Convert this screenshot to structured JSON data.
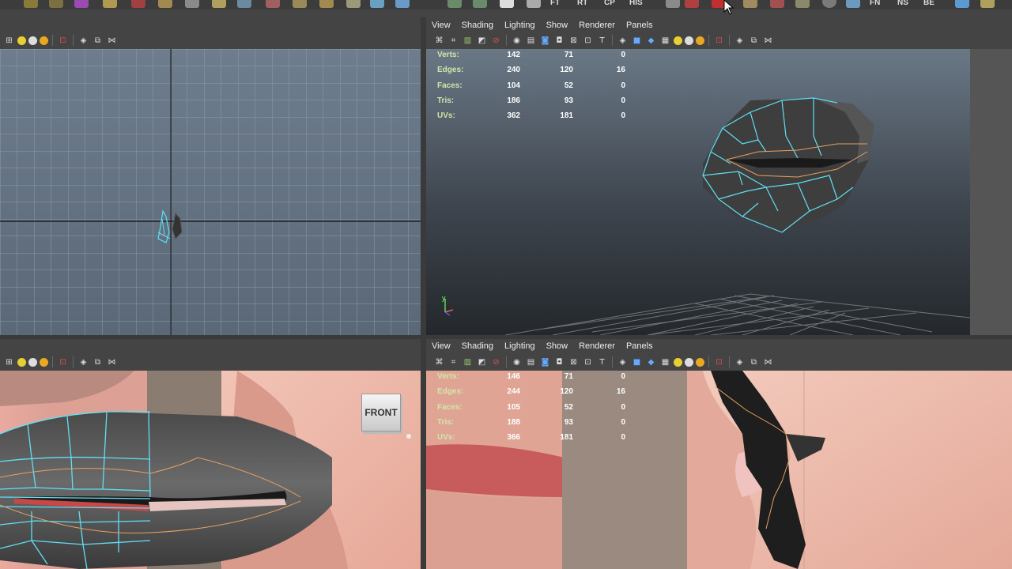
{
  "shelf": {
    "tabs": [
      "FT",
      "RT",
      "CP",
      "HIS",
      "FN",
      "NS",
      "BE"
    ],
    "icons": [
      "sphere-icon",
      "cube-icon",
      "cylinder-icon",
      "plane-icon",
      "lattice-icon",
      "bend-icon",
      "curve-icon",
      "text-icon",
      "camera-icon",
      "light-icon"
    ]
  },
  "panels": {
    "menu": [
      "View",
      "Shading",
      "Lighting",
      "Show",
      "Renderer",
      "Panels"
    ]
  },
  "viewports": {
    "top_left": {
      "name": "top view"
    },
    "top_right": {
      "hud": [
        {
          "label": "Verts:",
          "v1": "142",
          "v2": "71",
          "v3": "0"
        },
        {
          "label": "Edges:",
          "v1": "240",
          "v2": "120",
          "v3": "16"
        },
        {
          "label": "Faces:",
          "v1": "104",
          "v2": "52",
          "v3": "0"
        },
        {
          "label": "Tris:",
          "v1": "186",
          "v2": "93",
          "v3": "0"
        },
        {
          "label": "UVs:",
          "v1": "362",
          "v2": "181",
          "v3": "0"
        }
      ]
    },
    "bottom_left": {
      "view_cube_label": "FRONT"
    },
    "bottom_right": {
      "hud": [
        {
          "label": "Verts:",
          "v1": "146",
          "v2": "71",
          "v3": "0"
        },
        {
          "label": "Edges:",
          "v1": "244",
          "v2": "120",
          "v3": "16"
        },
        {
          "label": "Faces:",
          "v1": "105",
          "v2": "52",
          "v3": "0"
        },
        {
          "label": "Tris:",
          "v1": "188",
          "v2": "93",
          "v3": "0"
        },
        {
          "label": "UVs:",
          "v1": "366",
          "v2": "181",
          "v3": "0"
        }
      ]
    }
  },
  "colors": {
    "wire_selected": "#5fe0f5",
    "wire_edge": "#e8a060",
    "skin": "#d89a8a",
    "lip": "#c8504e"
  }
}
